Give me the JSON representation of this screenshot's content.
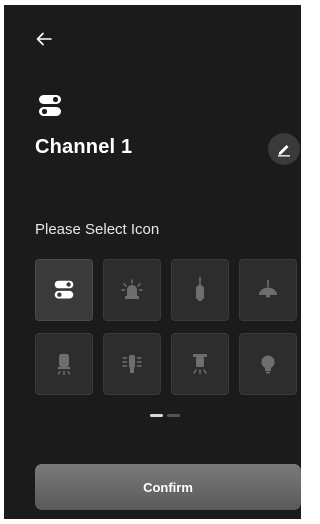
{
  "header": {
    "back_icon": "arrow-left-icon"
  },
  "channel": {
    "icon": "toggle-switch-icon",
    "title": "Channel 1",
    "edit_icon": "pencil-icon"
  },
  "icon_picker": {
    "label": "Please Select Icon",
    "selected_index": 0,
    "icons": [
      "toggle-switch-icon",
      "siren-icon",
      "pendant-lamp-icon",
      "dome-lamp-icon",
      "spotlight-icon",
      "led-bulb-icon",
      "ceiling-lamp-icon",
      "bulb-icon"
    ],
    "page_count": 2,
    "active_page": 1
  },
  "confirm_label": "Confirm",
  "colors": {
    "background": "#1b1b1b",
    "tile": "#2d2d2d",
    "icon_inactive": "#6e6e6e",
    "icon_active": "#ffffff",
    "button": "#6a6a6a"
  }
}
